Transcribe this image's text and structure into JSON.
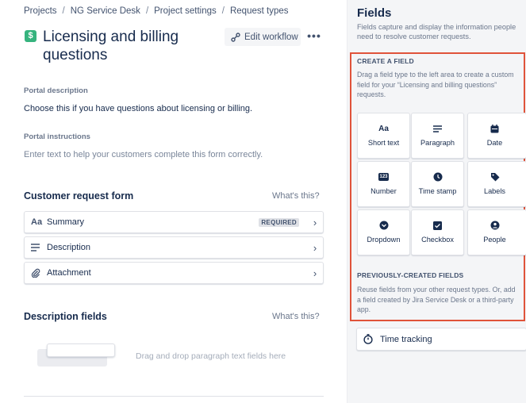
{
  "breadcrumb": [
    "Projects",
    "NG Service Desk",
    "Project settings",
    "Request types"
  ],
  "request_type": {
    "icon_glyph": "$",
    "icon_color": "#36b37e",
    "title": "Licensing and billing questions"
  },
  "toolbar": {
    "edit_workflow_label": "Edit workflow",
    "more_label": "•••"
  },
  "portal": {
    "description_label": "Portal description",
    "description_value": "Choose this if you have questions about licensing or billing.",
    "instructions_label": "Portal instructions",
    "instructions_placeholder": "Enter text to help your customers complete this form correctly."
  },
  "customer_form": {
    "title": "Customer request form",
    "help_link": "What's this?",
    "fields": [
      {
        "icon": "text-aa-icon",
        "icon_text": "Aa",
        "label": "Summary",
        "badge": "REQUIRED"
      },
      {
        "icon": "paragraph-lines-icon",
        "label": "Description",
        "badge": ""
      },
      {
        "icon": "paperclip-icon",
        "label": "Attachment",
        "badge": ""
      }
    ]
  },
  "description_fields": {
    "title": "Description fields",
    "help_link": "What's this?",
    "drop_hint": "Drag and drop paragraph text fields here"
  },
  "panel": {
    "title": "Fields",
    "description": "Fields capture and display the information people need to resolve customer requests.",
    "create_title": "CREATE A FIELD",
    "create_desc": "Drag a field type to the left area to create a custom field for your “Licensing and billing questions” requests.",
    "field_types": [
      {
        "icon": "text-aa-icon",
        "icon_text": "Aa",
        "label": "Short text"
      },
      {
        "icon": "paragraph-icon",
        "label": "Paragraph"
      },
      {
        "icon": "calendar-icon",
        "label": "Date"
      },
      {
        "icon": "number-123-icon",
        "icon_text": "123",
        "label": "Number"
      },
      {
        "icon": "clock-icon",
        "label": "Time stamp"
      },
      {
        "icon": "tag-icon",
        "label": "Labels"
      },
      {
        "icon": "dropdown-icon",
        "label": "Dropdown"
      },
      {
        "icon": "checkbox-icon",
        "label": "Checkbox"
      },
      {
        "icon": "person-icon",
        "label": "People"
      }
    ],
    "prev_title": "PREVIOUSLY-CREATED FIELDS",
    "prev_desc": "Reuse fields from your other request types. Or, add a field created by Jira Service Desk or a third-party app.",
    "time_tracking_label": "Time tracking",
    "highlight_color": "#e0533a"
  }
}
